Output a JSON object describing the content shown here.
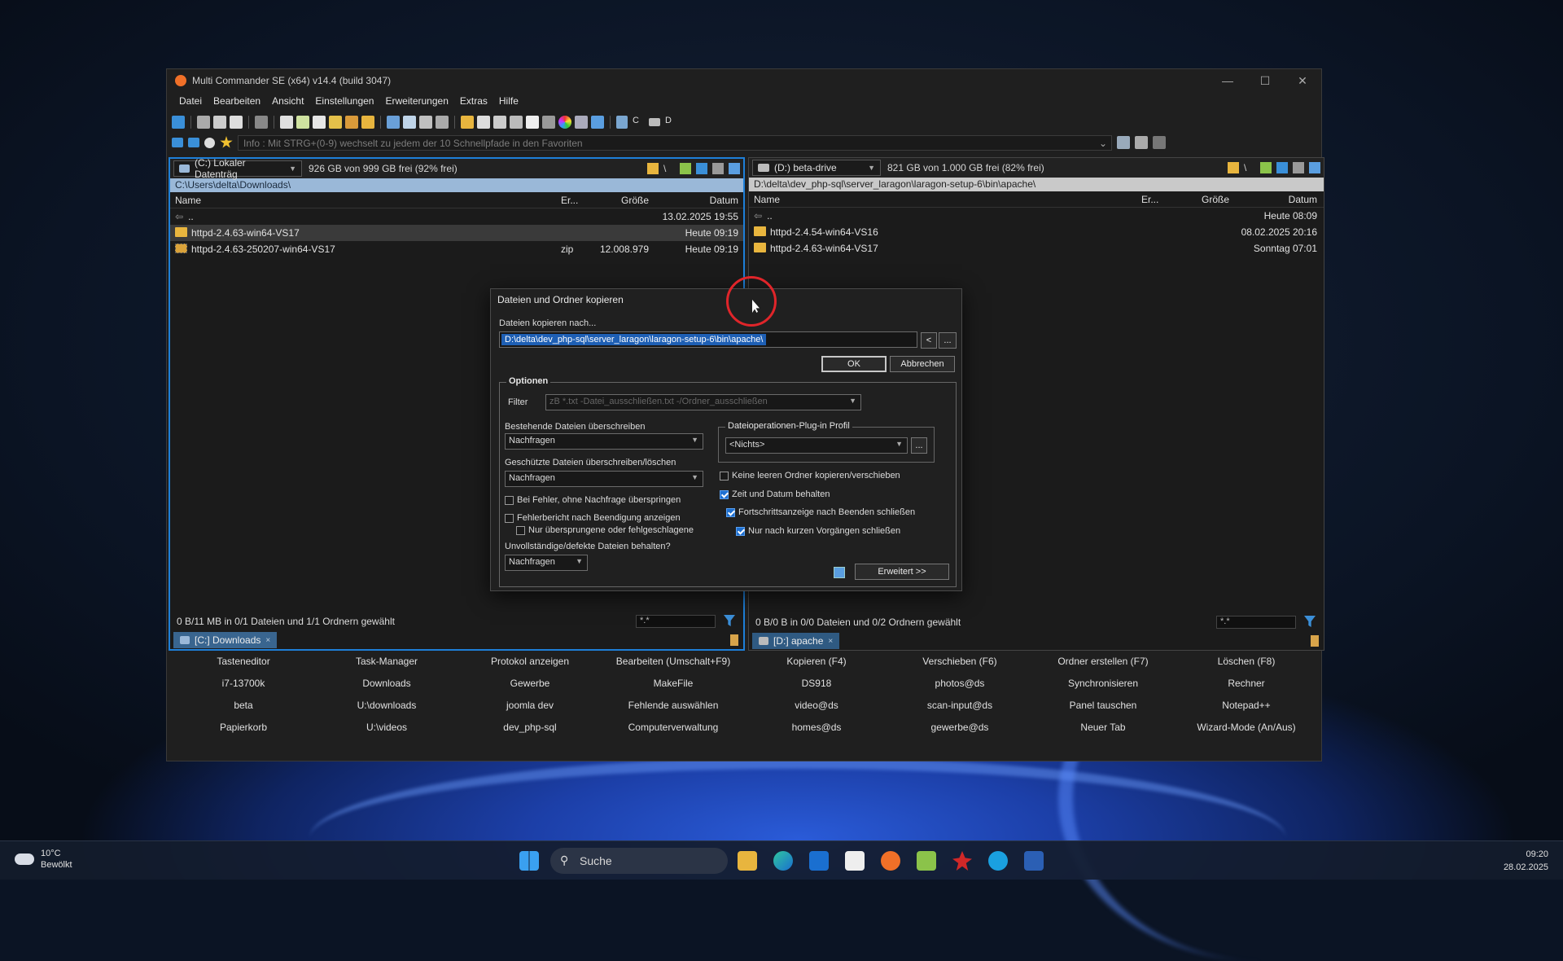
{
  "window": {
    "title": "Multi Commander SE (x64)  v14.4 (build 3047)",
    "controls": [
      "—",
      "☐",
      "✕"
    ]
  },
  "menu": [
    "Datei",
    "Bearbeiten",
    "Ansicht",
    "Einstellungen",
    "Erweiterungen",
    "Extras",
    "Hilfe"
  ],
  "toolbar": {
    "drive_c": "C",
    "drive_d": "D"
  },
  "favbar": {
    "info": "Info : Mit STRG+(0-9) wechselt zu jedem der 10 Schnellpfade in den Favoriten"
  },
  "left": {
    "drive": "(C:) Lokaler Datenträg",
    "free": "926 GB von 999 GB frei (92% frei)",
    "path": "C:\\Users\\delta\\Downloads\\",
    "headers": {
      "name": "Name",
      "ext": "Er...",
      "size": "Größe",
      "date": "Datum"
    },
    "rows": [
      {
        "name": "..",
        "ext": "",
        "size": "",
        "date": "13.02.2025 19:55"
      },
      {
        "name": "httpd-2.4.63-win64-VS17",
        "ext": "",
        "size": "",
        "date": "Heute 09:19"
      },
      {
        "name": "httpd-2.4.63-250207-win64-VS17",
        "ext": "zip",
        "size": "12.008.979",
        "date": "Heute 09:19"
      }
    ],
    "status": "0 B/11 MB in 0/1 Dateien und 1/1 Ordnern gewählt",
    "filter": "*.*",
    "tab": "[C:] Downloads"
  },
  "right": {
    "drive": "(D:) beta-drive",
    "free": "821 GB von 1.000 GB frei (82% frei)",
    "path": "D:\\delta\\dev_php-sql\\server_laragon\\laragon-setup-6\\bin\\apache\\",
    "headers": {
      "name": "Name",
      "ext": "Er...",
      "size": "Größe",
      "date": "Datum"
    },
    "rows": [
      {
        "name": "..",
        "date": "Heute 08:09"
      },
      {
        "name": "httpd-2.4.54-win64-VS16",
        "date": "08.02.2025 20:16"
      },
      {
        "name": "httpd-2.4.63-win64-VS17",
        "date": "Sonntag 07:01"
      }
    ],
    "status": "0 B/0 B in 0/0 Dateien und 0/2 Ordnern gewählt",
    "filter": "*.*",
    "tab": "[D:] apache"
  },
  "buttons": [
    "Tasteneditor",
    "Task-Manager",
    "Protokol anzeigen",
    "Bearbeiten (Umschalt+F9)",
    "Kopieren (F4)",
    "Verschieben (F6)",
    "Ordner erstellen (F7)",
    "Löschen (F8)",
    "i7-13700k",
    "Downloads",
    "Gewerbe",
    "MakeFile",
    "DS918",
    "photos@ds",
    "Synchronisieren",
    "Rechner",
    "beta",
    "U:\\downloads",
    "joomla dev",
    "Fehlende auswählen",
    "video@ds",
    "scan-input@ds",
    "Panel tauschen",
    "Notepad++",
    "Papierkorb",
    "U:\\videos",
    "dev_php-sql",
    "Computerverwaltung",
    "homes@ds",
    "gewerbe@ds",
    "Neuer Tab",
    "Wizard-Mode (An/Aus)"
  ],
  "dialog": {
    "title": "Dateien und Ordner kopieren",
    "dest_label": "Dateien kopieren nach...",
    "dest_value": "D:\\delta\\dev_php-sql\\server_laragon\\laragon-setup-6\\bin\\apache\\",
    "ok": "OK",
    "cancel": "Abbrechen",
    "back_btn": "<",
    "browse_btn": "...",
    "options_title": "Optionen",
    "filter_label": "Filter",
    "filter_placeholder": "zB *.txt -Datei_ausschließen.txt -/Ordner_ausschließen",
    "overwrite_label": "Bestehende Dateien überschreiben",
    "overwrite_value": "Nachfragen",
    "protected_label": "Geschützte Dateien überschreiben/löschen",
    "protected_value": "Nachfragen",
    "cb_skip_errors": "Bei Fehler, ohne Nachfrage überspringen",
    "cb_error_report": "Fehlerbericht nach Beendigung anzeigen",
    "cb_only_skipped": "Nur übersprungene oder fehlgeschlagene",
    "incomplete_label": "Unvollständige/defekte Dateien behalten?",
    "incomplete_value": "Nachfragen",
    "plugin_label": "Dateioperationen-Plug-in Profil",
    "plugin_value": "<Nichts>",
    "plugin_browse": "...",
    "cb_no_empty": "Keine leeren Ordner kopieren/verschieben",
    "cb_keep_time": "Zeit und Datum behalten",
    "cb_close_progress": "Fortschrittsanzeige nach Beenden schließen",
    "cb_short_only": "Nur nach kurzen Vorgängen schließen",
    "advanced": "Erweitert >>"
  },
  "taskbar": {
    "temp": "10°C",
    "weather": "Bewölkt",
    "search": "Suche",
    "time": "09:20",
    "date": "28.02.2025"
  }
}
